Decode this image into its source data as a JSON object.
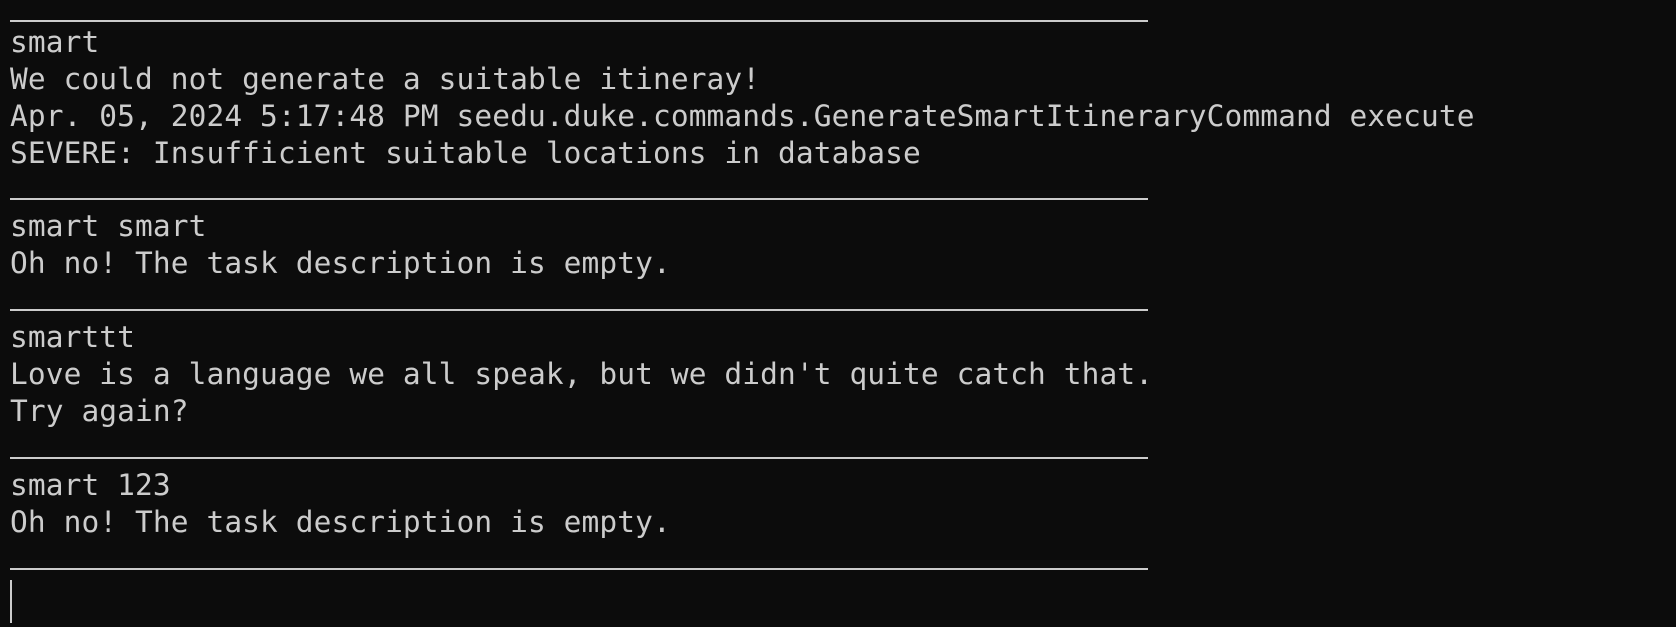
{
  "terminal": {
    "blocks": [
      {
        "input": "smart",
        "output": [
          "We could not generate a suitable itineray!",
          "Apr. 05, 2024 5:17:48 PM seedu.duke.commands.GenerateSmartItineraryCommand execute",
          "SEVERE: Insufficient suitable locations in database"
        ]
      },
      {
        "input": "smart smart",
        "output": [
          "Oh no! The task description is empty."
        ]
      },
      {
        "input": "smarttt",
        "output": [
          "Love is a language we all speak, but we didn't quite catch that.",
          "Try again?"
        ]
      },
      {
        "input": "smart 123",
        "output": [
          "Oh no! The task description is empty."
        ]
      }
    ]
  }
}
